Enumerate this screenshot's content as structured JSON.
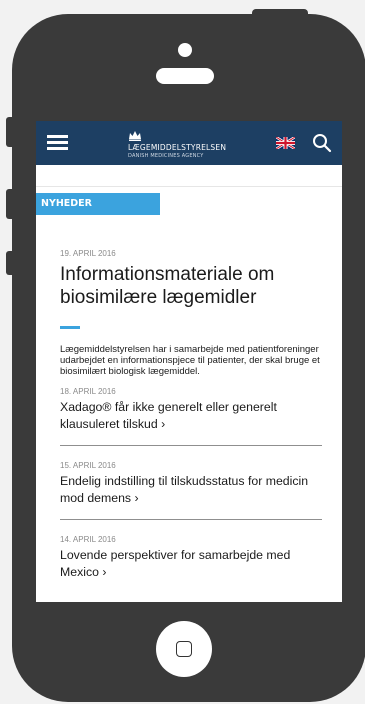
{
  "header": {
    "logo_main": "LÆGEMIDDELSTYRELSEN",
    "logo_sub": "DANISH MEDICINES AGENCY",
    "menu_icon": "hamburger-icon",
    "language_icon": "uk-flag-icon",
    "search_icon": "search-icon"
  },
  "section": {
    "label": "NYHEDER"
  },
  "featured": {
    "date": "19. APRIL 2016",
    "title": "Informationsmateriale om biosimilære lægemidler",
    "text": "Lægemiddelstyrelsen har i samarbejde med patientforeninger udarbejdet en informationspjece til patienter, der skal bruge et biosimilært biologisk lægemiddel."
  },
  "news": [
    {
      "date": "18. APRIL 2016",
      "title": "Xadago® får ikke generelt eller generelt klausuleret tilskud ›"
    },
    {
      "date": "15. APRIL 2016",
      "title": "Endelig indstilling til tilskudsstatus for medicin mod demens ›"
    },
    {
      "date": "14. APRIL 2016",
      "title": "Lovende perspektiver for samarbejde med Mexico ›"
    }
  ],
  "colors": {
    "header_bg": "#1d3f63",
    "accent": "#3ba3de",
    "phone": "#3a3a3a"
  }
}
